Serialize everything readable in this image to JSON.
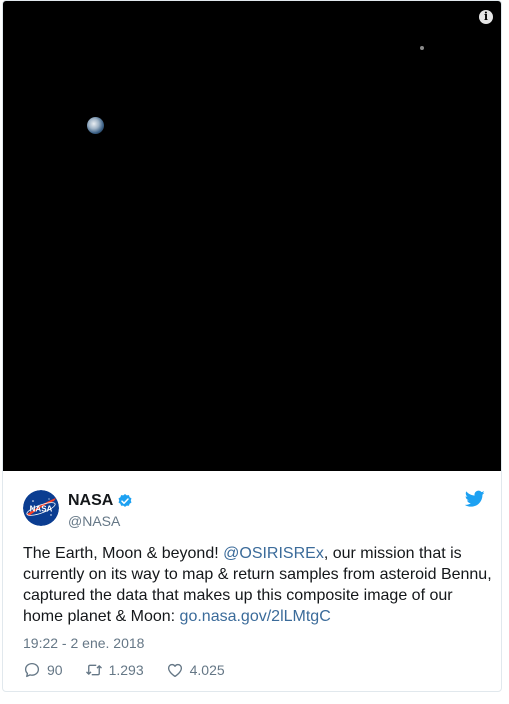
{
  "media": {
    "info_icon": "i",
    "colors": {
      "background": "#000000"
    }
  },
  "author": {
    "display_name": "NASA",
    "handle": "@NASA",
    "verified": true,
    "logo_text": "NASA"
  },
  "tweet": {
    "text_1": "The Earth, Moon & beyond! ",
    "mention": "@OSIRISREx",
    "text_2": ", our mission that is currently on its way to map & return samples from asteroid Bennu, captured the data that makes up this composite image of our home planet & Moon: ",
    "link": "go.nasa.gov/2lLMtgC",
    "timestamp": "19:22 - 2 ene. 2018"
  },
  "actions": {
    "replies": "90",
    "retweets": "1.293",
    "likes": "4.025"
  },
  "colors": {
    "link": "#3b6b9a",
    "twitter_blue": "#1da1f2",
    "muted": "#657786"
  }
}
